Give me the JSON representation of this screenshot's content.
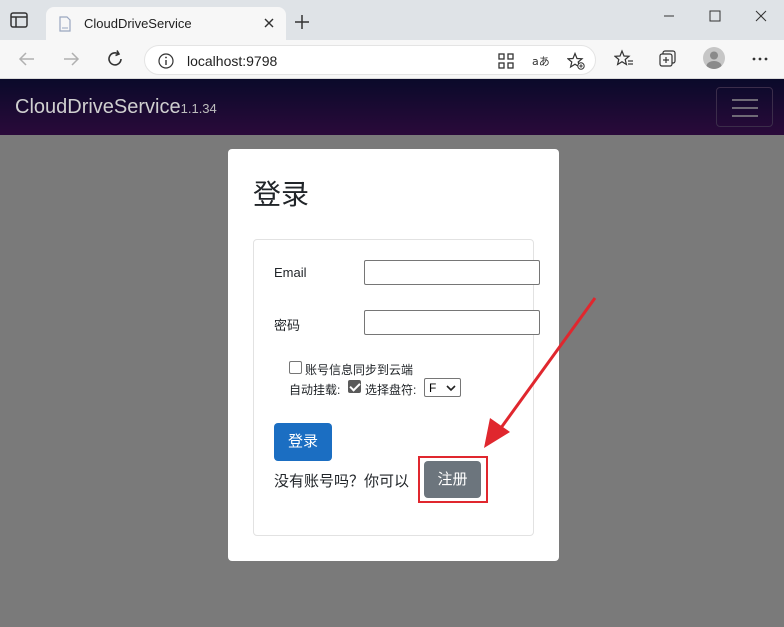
{
  "browser": {
    "tab_title": "CloudDriveService",
    "url": "localhost:9798"
  },
  "app": {
    "brand": "CloudDriveService",
    "version": "1.1.34"
  },
  "login": {
    "title": "登录",
    "email_label": "Email",
    "email_value": "",
    "password_label": "密码",
    "password_value": "",
    "sync_label": "账号信息同步到云端",
    "sync_checked": false,
    "automount_label": "自动挂载:",
    "automount_checked": true,
    "drive_label": "选择盘符:",
    "drive_value": "F",
    "login_button": "登录",
    "register_prompt": "没有账号吗？你可以",
    "register_button": "注册"
  },
  "annotation": {
    "color": "#e0272e"
  }
}
